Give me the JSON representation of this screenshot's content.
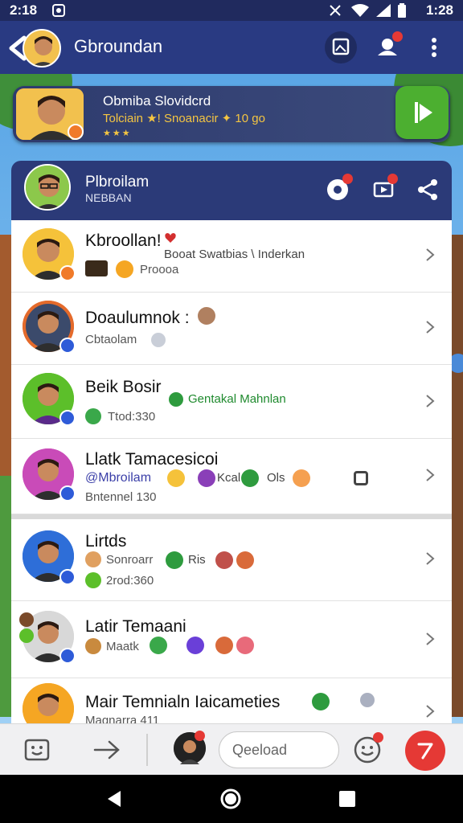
{
  "status": {
    "time_left": "2:18",
    "time_right": "1:28"
  },
  "app_bar": {
    "title": "Gbroundan"
  },
  "featured": {
    "title": "Obmiba Slovidcrd",
    "subtitle": "Tolciain ★! Snoanacir ✦ 10 go",
    "stars": "★★★"
  },
  "group": {
    "title": "Plbroilam",
    "subtitle": "NEBBAN"
  },
  "rows": [
    {
      "name": "Kbroollan!",
      "line2": "Proooa",
      "mid": "Booat Swatbias \\ Inderkan"
    },
    {
      "name": "Doaulumnok :",
      "line2": "Cbtaolam"
    },
    {
      "name": "Beik Bosir",
      "line2": "Ttod:330",
      "mid": "Gentakal Mahnlan"
    },
    {
      "name": "Llatk Tamacesicoi",
      "line2": "Bntennel 130",
      "mention": "@Mbroilam",
      "mid": "Kcal",
      "mid2": "Ols"
    },
    {
      "name": "Lirtds",
      "line2": "Sonroarr",
      "line3": "2rod:360",
      "mid": "Ris"
    },
    {
      "name": "Latir Temaani",
      "line2": "Maatk"
    },
    {
      "name": "Mair Temnialn Iaicameties",
      "line2": "Magnarra 411"
    }
  ],
  "input": {
    "placeholder": "Qeeload"
  },
  "colors": {
    "primary": "#293a82",
    "accent_green": "#4caf30",
    "send_red": "#e53935"
  }
}
